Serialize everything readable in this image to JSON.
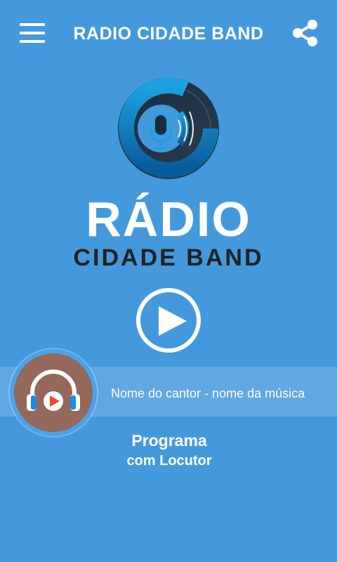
{
  "header": {
    "title": "RADIO CIDADE BAND",
    "menu_icon": "hamburger-menu-icon",
    "share_icon": "share-icon"
  },
  "logo": {
    "line1": "RÁDIO",
    "line2": "CIDADE BAND"
  },
  "player": {
    "play_icon": "play-icon",
    "now_playing": "Nome do cantor - nome da música",
    "album_icon": "headphones-icon"
  },
  "program": {
    "title": "Programa",
    "host": "com Locutor"
  },
  "colors": {
    "background": "#4499dd",
    "album_bg": "#94685b",
    "text": "#ffffff"
  }
}
